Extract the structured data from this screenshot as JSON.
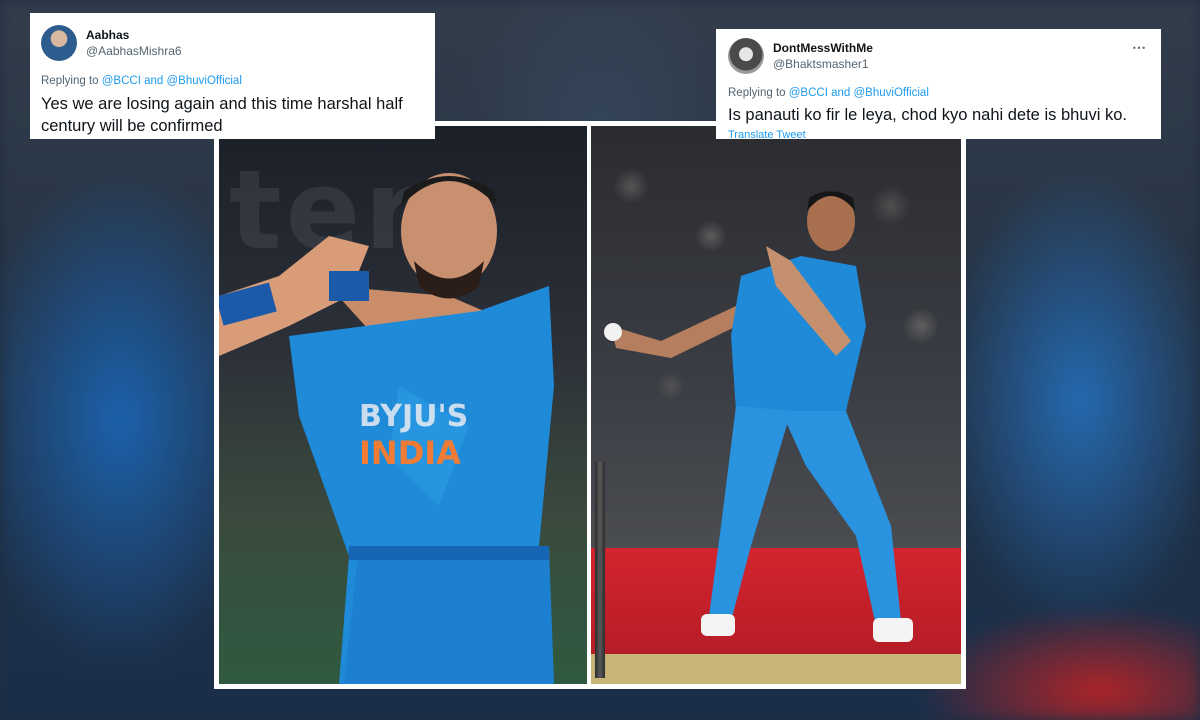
{
  "tweets": [
    {
      "display_name": "Aabhas",
      "handle": "@AabhasMishra6",
      "reply_prefix": "Replying to",
      "mention_1": "@BCCI",
      "conjunction": "and",
      "mention_2": "@BhuviOfficial",
      "text": "Yes we are losing again and this time harshal half century will be confirmed",
      "avatar_icon": "user-avatar"
    },
    {
      "display_name": "DontMessWithMe",
      "handle": "@Bhaktsmasher1",
      "reply_prefix": "Replying to",
      "mention_1": "@BCCI",
      "conjunction": "and",
      "mention_2": "@BhuviOfficial",
      "text": "Is panauti ko fir le leya, chod kyo nahi dete is bhuvi ko.",
      "translate_label": "Translate Tweet",
      "more_icon": "more-options-icon",
      "avatar_icon": "user-avatar"
    }
  ],
  "photo": {
    "left_jersey_text": "INDIA",
    "colors": {
      "jersey_blue": "#1f8ad8",
      "mention_blue": "#1d9bf0",
      "ad_red": "#d3242d"
    }
  }
}
